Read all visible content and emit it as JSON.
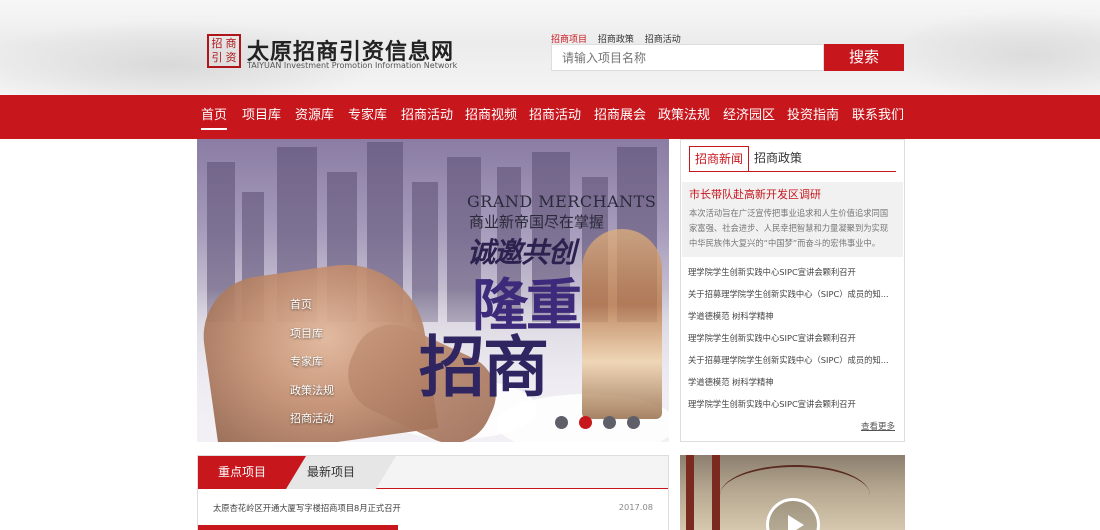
{
  "header": {
    "logo_seal": [
      "招",
      "商",
      "引",
      "资"
    ],
    "site_title": "太原招商引资信息网",
    "site_subtitle": "TAIYUAN Investment Promotion Information Network",
    "quick_links": [
      "招商项目",
      "招商政策",
      "招商活动"
    ],
    "search_placeholder": "请输入项目名称",
    "search_button": "搜索"
  },
  "nav": {
    "items": [
      "首页",
      "项目库",
      "资源库",
      "专家库",
      "招商活动",
      "招商视频",
      "招商活动",
      "招商展会",
      "政策法规",
      "经济园区",
      "投资指南",
      "联系我们"
    ],
    "active_index": 0
  },
  "banner": {
    "title_en": "GRAND MERCHANTS",
    "title_cn": "商业新帝国尽在掌握",
    "slogan1": "诚邀共创",
    "slogan2": "隆重",
    "slogan3": "招商",
    "side_menu": [
      "首页",
      "项目库",
      "专家库",
      "政策法规",
      "招商活动"
    ],
    "slide_count": 4,
    "active_slide": 1
  },
  "news": {
    "tabs": [
      "招商新闻",
      "招商政策"
    ],
    "featured_title": "市长带队赴高新开发区调研",
    "featured_desc": "本次活动旨在广泛宣传把事业追求和人生价值追求同国家富强、社会进步、人民幸把智慧和力量凝聚到为实现中华民族伟大复兴的“中国梦”而奋斗的宏伟事业中。",
    "items": [
      "理学院学生创新实践中心SIPC宣讲会颗利召开",
      "关于招募理学院学生创新实践中心（SIPC）成员的知...",
      "学道德模范 树科学精神",
      "理学院学生创新实践中心SIPC宣讲会颗利召开",
      "关于招募理学院学生创新实践中心（SIPC）成员的知...",
      "学道德模范 树科学精神",
      "理学院学生创新实践中心SIPC宣讲会颗利召开"
    ],
    "more": "查看更多"
  },
  "projects": {
    "tabs": [
      "重点项目",
      "最新项目"
    ],
    "rows": [
      {
        "title": "太原杏花岭区开通大厦写字楼招商项目8月正式召开",
        "date": "2017.08"
      }
    ]
  },
  "colors": {
    "brand_red": "#c8161d"
  }
}
